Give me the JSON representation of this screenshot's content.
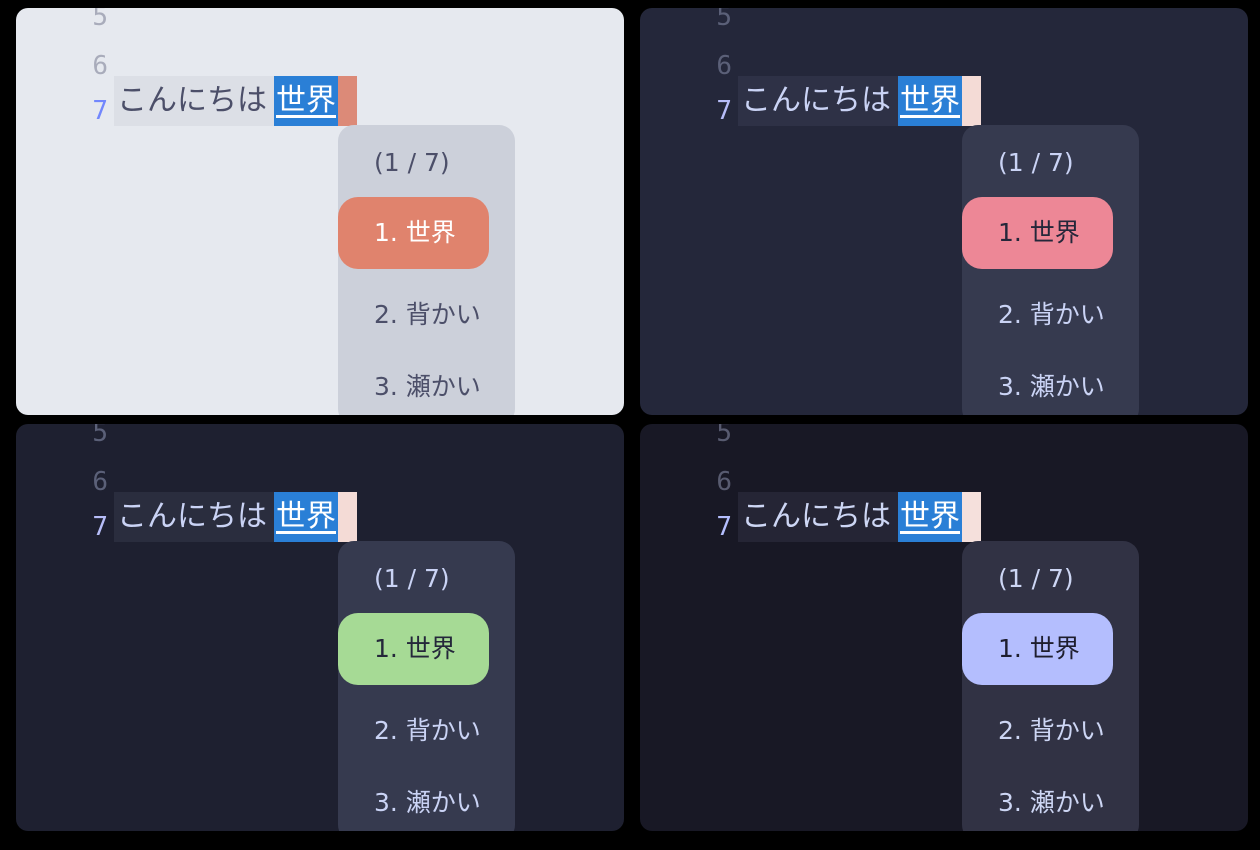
{
  "editor": {
    "line_numbers": [
      "5",
      "6",
      "7"
    ],
    "committed_text": "こんにちは",
    "preedit_text": "世界"
  },
  "candidates": {
    "counter": "(1 / 7)",
    "items": [
      "1. 世界",
      "2. 背かい",
      "3. 瀬かい"
    ]
  },
  "panels": [
    {
      "theme_colors": {
        "background": "#e6e9ef",
        "line_number": "#a9acbb",
        "current_line_number": "#7287fd",
        "line_highlight": "#dcdfe6",
        "text": "#4c4f69",
        "cursor": "#dc8a78",
        "popup": "#ccd0da",
        "selection": "#e0836d",
        "selection_text": "#ffffff",
        "candidate_text": "#4c4f69"
      }
    },
    {
      "theme_colors": {
        "background": "#24273a",
        "line_number": "#5b6078",
        "current_line_number": "#b7bdf8",
        "line_highlight": "#2e3146",
        "text": "#cad3f5",
        "cursor": "#f4dbd6",
        "popup": "#363a4f",
        "selection": "#ed8796",
        "selection_text": "#24273a",
        "candidate_text": "#cad3f5"
      }
    },
    {
      "theme_colors": {
        "background": "#1e2030",
        "line_number": "#5b6078",
        "current_line_number": "#b7bdf8",
        "line_highlight": "#2a2d3e",
        "text": "#cad3f5",
        "cursor": "#f4dbd6",
        "popup": "#363a4f",
        "selection": "#a6da95",
        "selection_text": "#24273a",
        "candidate_text": "#cad3f5"
      }
    },
    {
      "theme_colors": {
        "background": "#181825",
        "line_number": "#585b70",
        "current_line_number": "#b4befe",
        "line_highlight": "#252535",
        "text": "#cdd6f4",
        "cursor": "#f5e0dc",
        "popup": "#313244",
        "selection": "#b4befe",
        "selection_text": "#1e1e2e",
        "candidate_text": "#cdd6f4"
      }
    }
  ]
}
